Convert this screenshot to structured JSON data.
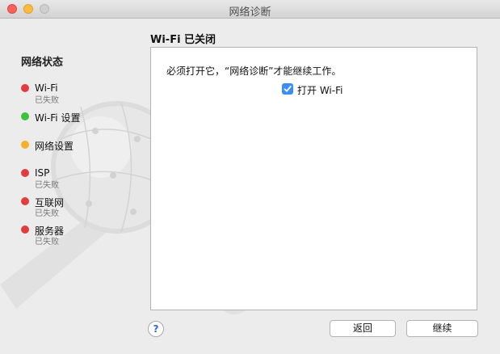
{
  "window": {
    "title": "网络诊断"
  },
  "sidebar": {
    "title": "网络状态",
    "steps": [
      {
        "label": "Wi-Fi",
        "status": "已失败",
        "color": "#e23d3d"
      },
      {
        "label": "Wi-Fi 设置",
        "status": "",
        "color": "#3cc23c"
      },
      {
        "label": "网络设置",
        "status": "",
        "color": "#f5b12d"
      },
      {
        "label": "ISP",
        "status": "已失败",
        "color": "#e23d3d"
      },
      {
        "label": "互联网",
        "status": "已失败",
        "color": "#e23d3d"
      },
      {
        "label": "服务器",
        "status": "已失败",
        "color": "#e23d3d"
      }
    ]
  },
  "main": {
    "title": "Wi-Fi 已关闭",
    "message": "必须打开它，“网络诊断”才能继续工作。",
    "checkbox_label": "打开 Wi-Fi",
    "checkbox_checked": true
  },
  "footer": {
    "help_icon": "?",
    "back_label": "返回",
    "continue_label": "继续"
  },
  "colors": {
    "accent": "#3a8ef6"
  }
}
